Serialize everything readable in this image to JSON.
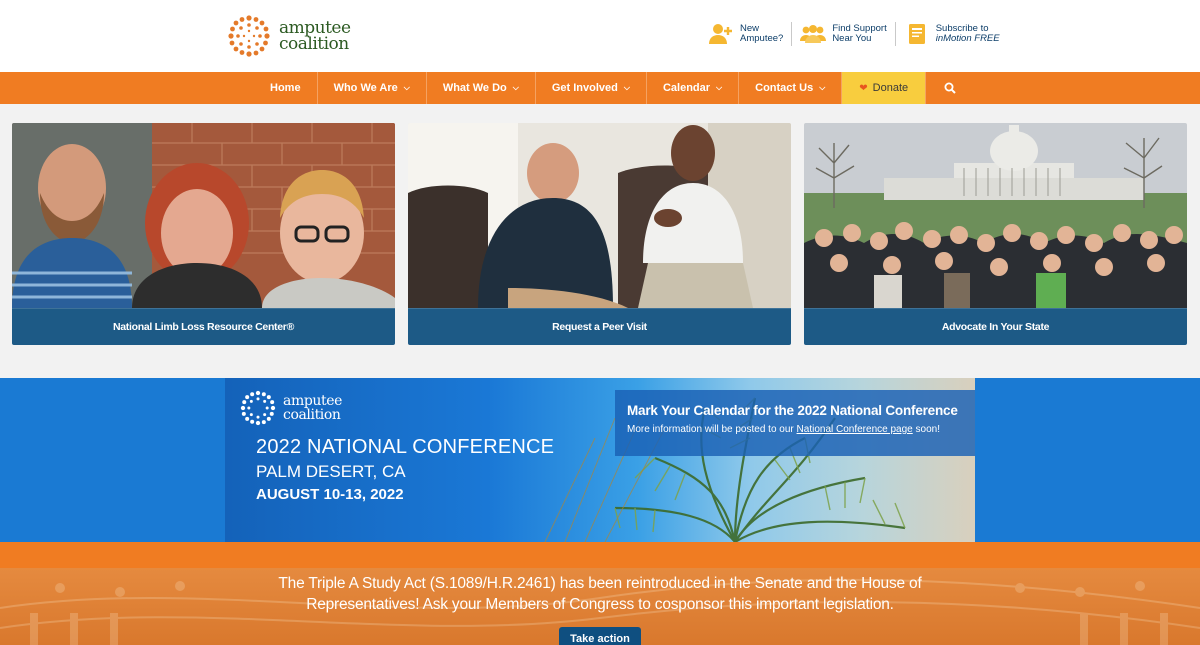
{
  "header": {
    "logo": {
      "line1": "amputee",
      "line2": "coalition"
    },
    "quick_links": [
      {
        "line1": "New",
        "line2": "Amputee?",
        "icon": "add-person-icon"
      },
      {
        "line1": "Find Support",
        "line2": "Near You",
        "icon": "group-icon"
      },
      {
        "line1": "Subscribe to",
        "line2": "inMotion FREE",
        "icon": "magazine-icon"
      }
    ]
  },
  "nav": {
    "items": [
      "Home",
      "Who We Are",
      "What We Do",
      "Get Involved",
      "Calendar",
      "Contact Us"
    ],
    "donate": "Donate",
    "search_icon": "search-icon"
  },
  "cards": [
    {
      "caption": "National Limb Loss Resource Center®"
    },
    {
      "caption": "Request a Peer Visit"
    },
    {
      "caption": "Advocate In Your State"
    }
  ],
  "conference": {
    "logo": {
      "line1": "amputee",
      "line2": "coalition"
    },
    "title": "2022 NATIONAL CONFERENCE",
    "location": "PALM DESERT, CA",
    "dates": "AUGUST 10-13, 2022",
    "note_heading": "Mark Your Calendar for the 2022 National Conference",
    "note_prefix": "More information will be posted to our ",
    "note_link": "National Conference page",
    "note_suffix": " soon!"
  },
  "advocacy": {
    "text": "The Triple A Study Act (S.1089/H.R.2461) has been reintroduced in the Senate and the House of Representatives! Ask your Members of Congress to cosponsor this important legislation.",
    "button": "Take action"
  },
  "colors": {
    "orange": "#f07c22",
    "navy": "#1d5a86",
    "donate": "#f8cd3e",
    "blue": "#1a7ad3"
  }
}
